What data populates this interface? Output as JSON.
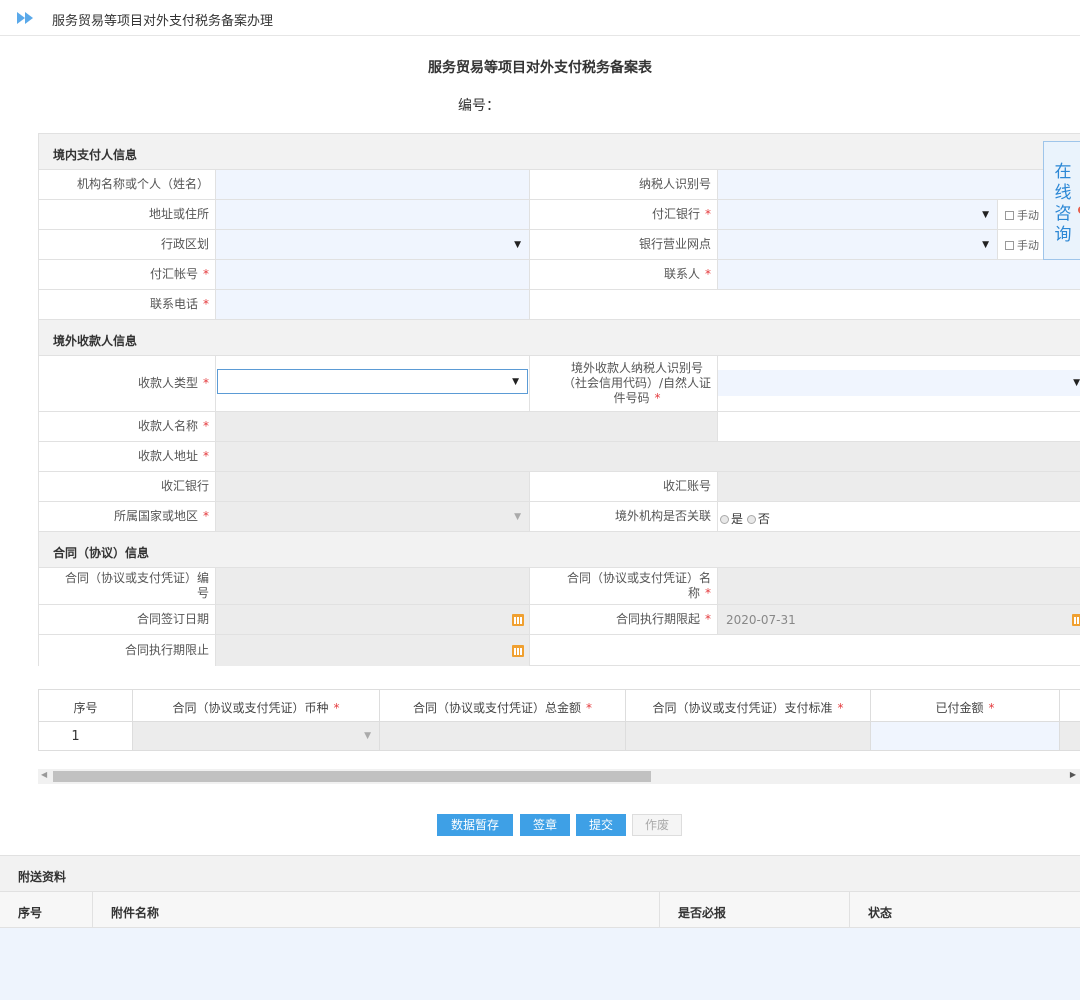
{
  "page": {
    "breadcrumb": "服务贸易等项目对外支付税务备案办理",
    "form_title": "服务贸易等项目对外支付税务备案表",
    "number_label": "编号："
  },
  "online_consult": "在线咨询",
  "section_domestic": {
    "title": "境内支付人信息",
    "org_name": "机构名称或个人（姓名）",
    "taxpayer_id": "纳税人识别号",
    "address": "地址或住所",
    "remit_bank": "付汇银行",
    "region": "行政区划",
    "bank_branch": "银行营业网点",
    "manual": "手动",
    "account": "付汇帐号",
    "contact": "联系人",
    "phone": "联系电话",
    "required_mark": "*"
  },
  "section_foreign": {
    "title": "境外收款人信息",
    "payee_type": "收款人类型",
    "payee_taxid_l1": "境外收款人纳税人识别号",
    "payee_taxid_l2": "（社会信用代码）/自然人证",
    "payee_taxid_l3": "件号码",
    "payee_name": "收款人名称",
    "payee_address": "收款人地址",
    "receive_bank": "收汇银行",
    "receive_account": "收汇账号",
    "country": "所属国家或地区",
    "related": "境外机构是否关联",
    "yes": "是",
    "no": "否"
  },
  "section_contract": {
    "title": "合同（协议）信息",
    "contract_no_l1": "合同（协议或支付凭证）编",
    "contract_no_l2": "号",
    "contract_name_l1": "合同（协议或支付凭证）名",
    "contract_name_l2": "称",
    "sign_date": "合同签订日期",
    "start_date_label": "合同执行期限起",
    "start_date_value": "2020-07-31",
    "end_date": "合同执行期限止"
  },
  "payment_table": {
    "headers": [
      "序号",
      "合同（协议或支付凭证）币种",
      "合同（协议或支付凭证）总金额",
      "合同（协议或支付凭证）支付标准",
      "已付金额"
    ],
    "row_index": "1"
  },
  "buttons": {
    "save": "数据暂存",
    "sign": "签章",
    "submit": "提交",
    "void": "作废"
  },
  "attachments": {
    "title": "附送资料",
    "headers": [
      "序号",
      "附件名称",
      "是否必报",
      "状态"
    ]
  },
  "colors": {
    "accent": "#3ea0e6",
    "required": "#e4393c",
    "field_blue": "#f0f5fe",
    "field_gray": "#ececec"
  }
}
